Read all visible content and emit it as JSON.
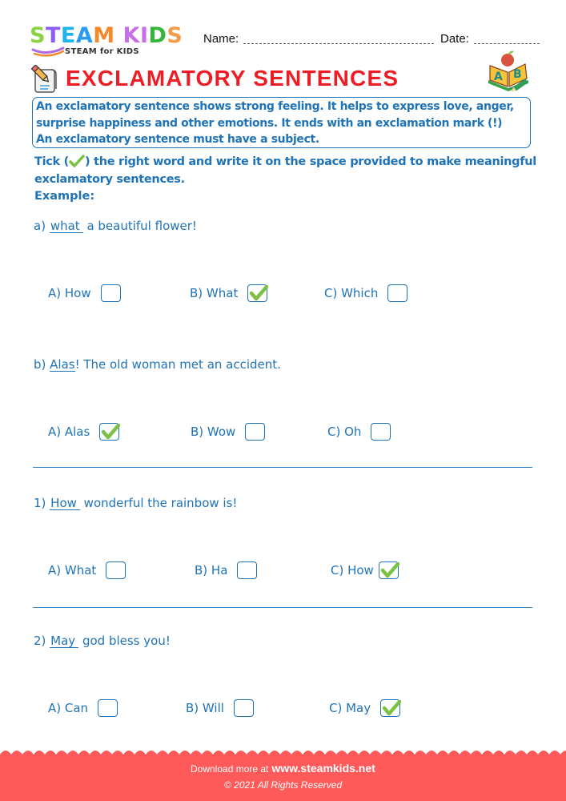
{
  "brand": {
    "logo_letters": [
      {
        "ch": "S",
        "color": "#8bd146"
      },
      {
        "ch": "T",
        "color": "#8b5cf6"
      },
      {
        "ch": "E",
        "color": "#1fb5ea"
      },
      {
        "ch": "A",
        "color": "#2b9cf0"
      },
      {
        "ch": "M",
        "color": "#f08a2b"
      },
      {
        "ch": " ",
        "color": "#ffffff"
      },
      {
        "ch": "K",
        "color": "#c86ee6"
      },
      {
        "ch": "I",
        "color": "#c86ee6"
      },
      {
        "ch": "D",
        "color": "#35b53a"
      },
      {
        "ch": "S",
        "color": "#f39b49"
      }
    ],
    "tagline": "STEAM for KIDS"
  },
  "header": {
    "name_label": "Name:",
    "date_label": "Date:"
  },
  "title": "EXCLAMATORY SENTENCES",
  "info": {
    "lines": [
      "An exclamatory sentence shows strong feeling. It helps to express love, anger,",
      "surprise happiness and other emotions. It ends with an exclamation mark (!)",
      "An exclamatory sentence must have a subject."
    ]
  },
  "instructions": {
    "line1_before": "Tick (",
    "line1_after": ") the right word and write it on the space provided to make meaningful",
    "line2": "exclamatory sentences.",
    "example_label": "Example:"
  },
  "questions": [
    {
      "prefix": "a) ",
      "answer": "what",
      "rest": " a beautiful flower!",
      "options": [
        {
          "label": "A) How",
          "checked": false
        },
        {
          "label": "B) What",
          "checked": true
        },
        {
          "label": "C) Which",
          "checked": false
        }
      ]
    },
    {
      "prefix": "b) ",
      "answer": "Alas",
      "rest": "! The old woman met an accident.",
      "options": [
        {
          "label": "A) Alas",
          "checked": true
        },
        {
          "label": "B) Wow",
          "checked": false
        },
        {
          "label": "C) Oh",
          "checked": false
        }
      ]
    },
    {
      "prefix": "1) ",
      "answer": "How",
      "rest": " wonderful the rainbow is!",
      "options": [
        {
          "label": "A) What",
          "checked": false
        },
        {
          "label": "B) Ha",
          "checked": false
        },
        {
          "label": "C) How",
          "checked": true
        }
      ]
    },
    {
      "prefix": "2) ",
      "answer": "May",
      "rest": " god bless you!",
      "options": [
        {
          "label": "A) Can",
          "checked": false
        },
        {
          "label": "B) Will",
          "checked": false
        },
        {
          "label": "C) May",
          "checked": true
        }
      ]
    }
  ],
  "footer": {
    "download_text": "Download more at",
    "url": "www.steamkids.net",
    "copyright": "©  2021 All Rights Reserved"
  },
  "colors": {
    "primary_blue": "#1f73b7",
    "title_red": "#ee1c25",
    "tick_green": "#7cc242",
    "footer_red": "#fe5a5a"
  }
}
